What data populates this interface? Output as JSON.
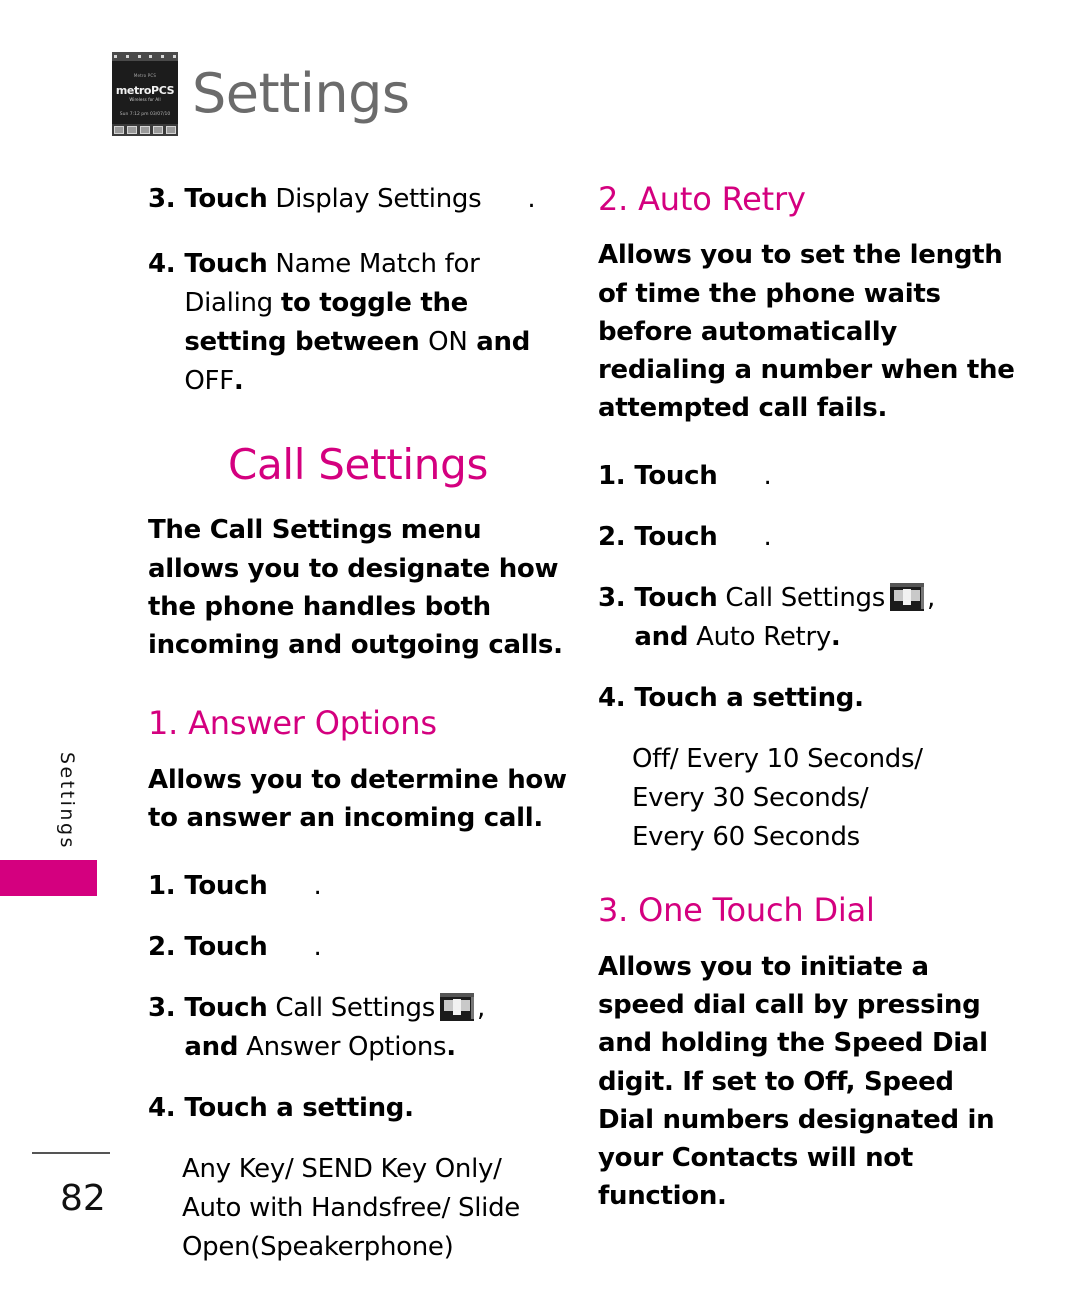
{
  "header": {
    "title": "Settings",
    "thumbnail": {
      "name": "phone-home-screen-thumbnail",
      "carrier_note": "Metro PCS",
      "brand": "metroPCS",
      "brand_sub": "Wireless for All",
      "clock_line": "Sun 7:12 pm 03/07/10"
    }
  },
  "side_tab": {
    "label": "Settings"
  },
  "footer": {
    "page_number": "82"
  },
  "colors": {
    "accent": "#d4007f",
    "title_gray": "#6b6b6b"
  },
  "left_column": {
    "continued_steps": [
      {
        "num": "3.",
        "bold_lead": "Touch",
        "text": " Display Settings",
        "has_blank_icon": true,
        "trailing": "."
      },
      {
        "num": "4.",
        "bold_lead": "Touch",
        "text": " Name Match for Dialing ",
        "bold_tail": "to toggle the setting between ",
        "plain_tail": "ON",
        "bold_tail2": " and ",
        "plain_tail2": "OFF",
        "trailing": "."
      }
    ],
    "section": {
      "title": "Call Settings",
      "intro": "The Call Settings menu allows you to designate how the phone handles both incoming and outgoing calls."
    },
    "subsection": {
      "title": "1. Answer Options",
      "description": "Allows you to determine how to answer an incoming call.",
      "steps": [
        {
          "num": "1.",
          "bold_lead": "Touch",
          "blank_icon": true,
          "trailing": "."
        },
        {
          "num": "2.",
          "bold_lead": "Touch",
          "blank_icon": true,
          "trailing": "."
        },
        {
          "num": "3.",
          "bold_lead": "Touch",
          "text": " Call Settings",
          "icon": "phone-screen-icon",
          "comma": ",",
          "second_line_bold": "and",
          "second_line_text": " Answer Options",
          "second_line_trailing": "."
        },
        {
          "num": "4.",
          "bold_lead": "Touch a setting.",
          "trailing": ""
        }
      ],
      "options": [
        "Any Key/ SEND Key Only/",
        "Auto with Handsfree/ Slide",
        "Open(Speakerphone)"
      ]
    }
  },
  "right_column": {
    "subsection_auto_retry": {
      "title": "2. Auto Retry",
      "description": "Allows you to set the length of time the phone waits before automatically redialing a number when the attempted call fails.",
      "steps": [
        {
          "num": "1.",
          "bold_lead": "Touch",
          "blank_icon": true,
          "trailing": "."
        },
        {
          "num": "2.",
          "bold_lead": "Touch",
          "blank_icon": true,
          "trailing": "."
        },
        {
          "num": "3.",
          "bold_lead": "Touch",
          "text": " Call Settings",
          "icon": "phone-screen-icon",
          "comma": ",",
          "second_line_bold": "and",
          "second_line_text": " Auto Retry",
          "second_line_trailing": "."
        },
        {
          "num": "4.",
          "bold_lead": "Touch a setting.",
          "trailing": ""
        }
      ],
      "options": [
        "Off/ Every 10 Seconds/",
        "Every 30 Seconds/",
        "Every 60 Seconds"
      ]
    },
    "subsection_one_touch_dial": {
      "title": "3. One Touch Dial",
      "description": "Allows you to initiate a speed dial call by pressing and holding the Speed Dial digit. If set to Off, Speed Dial numbers designated in your Contacts will not function."
    }
  }
}
